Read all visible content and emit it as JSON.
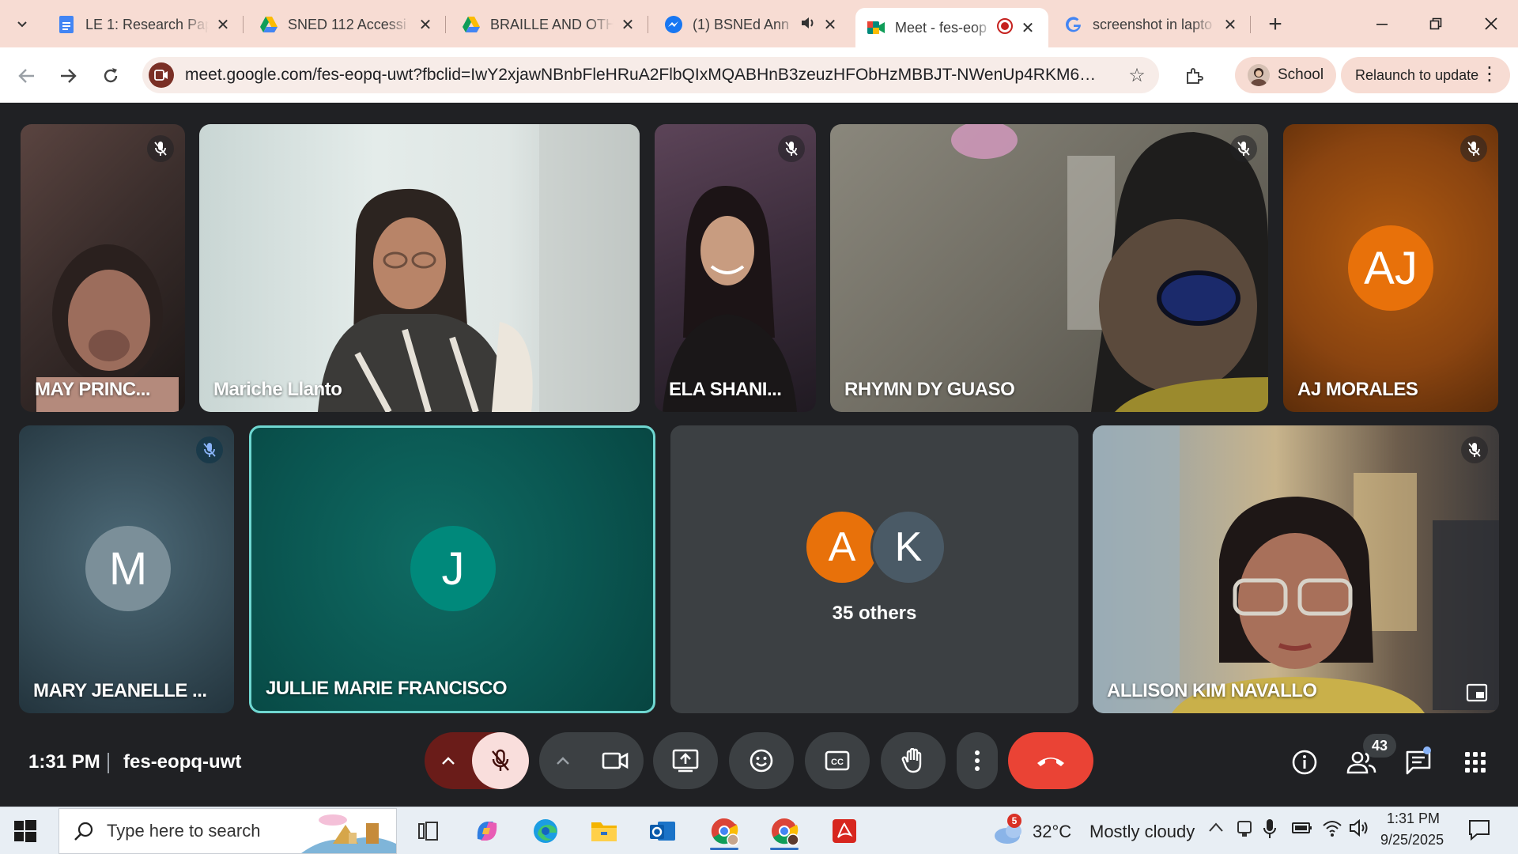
{
  "browser": {
    "tabs": [
      {
        "title": "LE 1: Research Pap",
        "icon": "google-docs-icon"
      },
      {
        "title": "SNED 112 Accessi",
        "icon": "google-drive-icon"
      },
      {
        "title": "BRAILLE AND OTH",
        "icon": "google-drive-icon"
      },
      {
        "title": "(1) BSNEd Ann",
        "icon": "messenger-icon"
      },
      {
        "title": "Meet - fes-eop",
        "icon": "google-meet-icon"
      },
      {
        "title": "screenshot in lapto",
        "icon": "google-icon"
      }
    ],
    "url": "meet.google.com/fes-eopq-uwt?fbclid=IwY2xjawNBnbFleHRuA2FlbQIxMQABHnB3zeuzHFObHzMBBJT-NWenUp4RKM6si9D...",
    "profile_label": "School",
    "relaunch_label": "Relaunch to update"
  },
  "meet": {
    "participants": [
      {
        "name": "MAY PRINC...",
        "muted": true
      },
      {
        "name": "Mariche Llanto",
        "muted": false
      },
      {
        "name": "ELA SHANI...",
        "muted": true
      },
      {
        "name": "RHYMN DY GUASO",
        "muted": true
      },
      {
        "name": "AJ MORALES",
        "initials": "AJ",
        "muted": true
      },
      {
        "name": "MARY JEANELLE ...",
        "initials": "M",
        "muted": true
      },
      {
        "name": "JULLIE MARIE FRANCISCO",
        "initials": "J",
        "muted": false
      },
      {
        "name": "35 others",
        "initials_a": "A",
        "initials_k": "K"
      },
      {
        "name": "ALLISON KIM NAVALLO",
        "muted": true
      }
    ],
    "time": "1:31 PM",
    "meeting_code": "fes-eopq-uwt",
    "people_count": "43",
    "colors": {
      "end_call": "#ea4335",
      "mic_off": "#f9dedc",
      "accent_teal": "#6fd7d1"
    }
  },
  "taskbar": {
    "search_placeholder": "Type here to search",
    "weather_temp": "32°C",
    "weather_text": "Mostly cloudy",
    "weather_badge": "5",
    "time": "1:31 PM",
    "date": "9/25/2025"
  }
}
